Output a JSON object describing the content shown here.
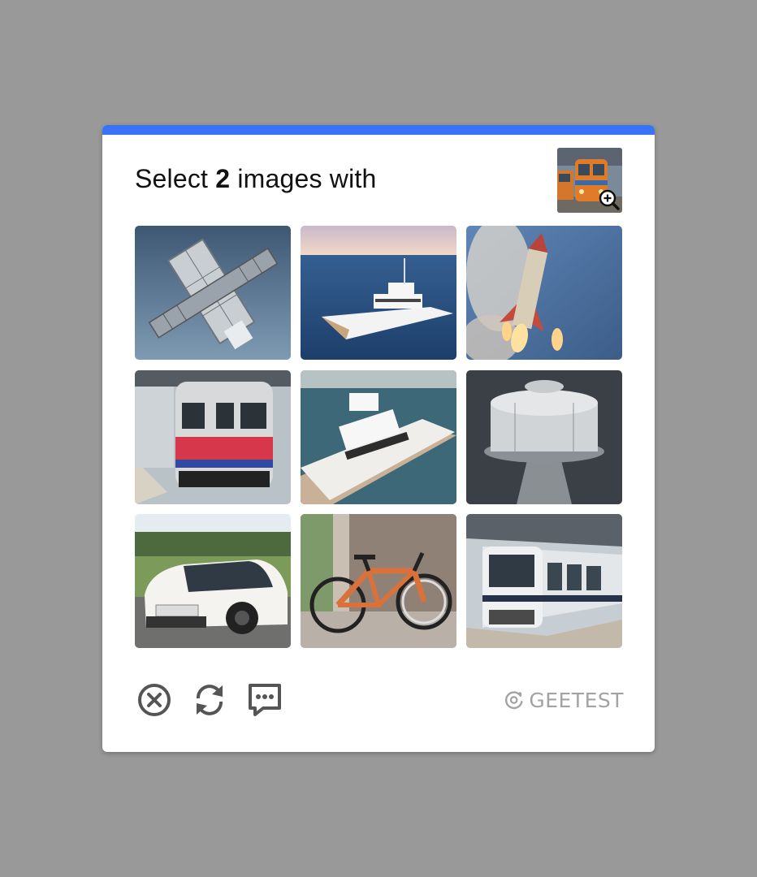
{
  "captcha": {
    "prompt_prefix": "Select",
    "prompt_count": "2",
    "prompt_suffix": "images with",
    "accent_color": "#3b73f7",
    "reference_image": "orange-train-thumbnail",
    "zoom_icon": "zoom-in-icon",
    "tiles": [
      {
        "subject": "satellite"
      },
      {
        "subject": "yacht"
      },
      {
        "subject": "rocket"
      },
      {
        "subject": "red-train"
      },
      {
        "subject": "yacht-aerial"
      },
      {
        "subject": "space-station-module"
      },
      {
        "subject": "white-car"
      },
      {
        "subject": "bicycle"
      },
      {
        "subject": "silver-train"
      }
    ],
    "footer": {
      "close_icon": "close-circle-icon",
      "refresh_icon": "refresh-icon",
      "feedback_icon": "feedback-chat-icon",
      "brand_text": "GEETEST"
    }
  }
}
